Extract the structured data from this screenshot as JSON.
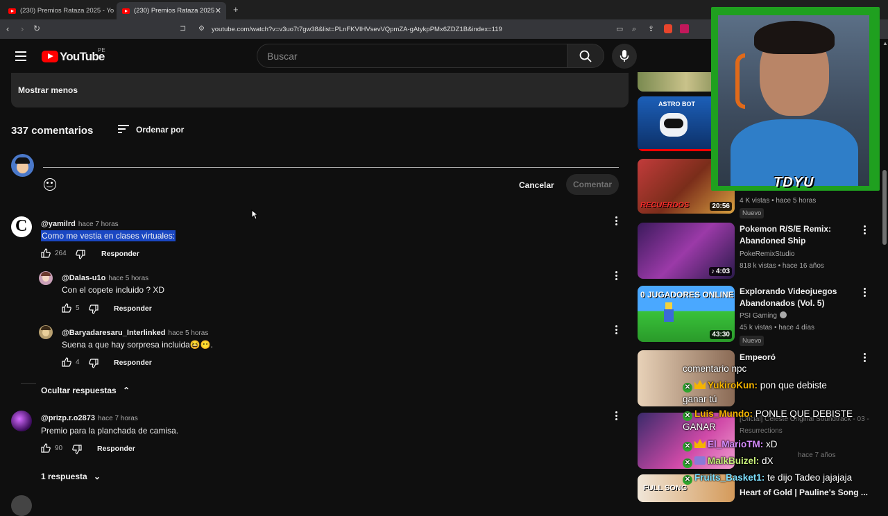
{
  "browser": {
    "tabs": [
      {
        "title": "(230) Premios Rataza 2025 - YouTube"
      },
      {
        "title": "(230) Premios Rataza 2025 - YouTube"
      }
    ],
    "new_tab_icon": "plus-icon",
    "url": "youtube.com/watch?v=v3uo7t7gw38&list=PLnFKVIHVsevVQpmZA-gAtykpPMx6ZDZ1B&index=119"
  },
  "header": {
    "logo_text": "YouTube",
    "country_code": "PE",
    "search_placeholder": "Buscar"
  },
  "description": {
    "show_less_label": "Mostrar menos"
  },
  "comments": {
    "count_label": "337 comentarios",
    "sort_label": "Ordenar por",
    "cancel_label": "Cancelar",
    "submit_label": "Comentar",
    "threads": [
      {
        "author": "@yamilrd",
        "time": "hace 7 horas",
        "text": "Como me vestia en clases virtuales:",
        "likes": "264",
        "reply_label": "Responder",
        "replies": [
          {
            "author": "@Dalas-u1o",
            "time": "hace 5 horas",
            "text": "Con el copete incluido ? XD",
            "likes": "5",
            "reply_label": "Responder"
          },
          {
            "author": "@Baryadaresaru_Interlinked",
            "time": "hace 5 horas",
            "text": "Suena a que hay sorpresa incluida",
            "emoji_suffix": "😆😶.",
            "likes": "4",
            "reply_label": "Responder"
          }
        ],
        "toggle_label": "Ocultar respuestas"
      },
      {
        "author": "@prizp.r.o2873",
        "time": "hace 7 horas",
        "text": "Premio para la planchada de camisa.",
        "likes": "90",
        "reply_label": "Responder",
        "toggle_label": "1 respuesta"
      }
    ]
  },
  "sidebar": {
    "videos": [
      {
        "duration": "",
        "title": "",
        "channel": "",
        "meta": ""
      },
      {
        "duration": "20:56",
        "thumb_text": "RECUERDOS",
        "meta": "4 K vistas • hace 5 horas",
        "badge": "Nuevo"
      },
      {
        "duration": "4:03",
        "title": "Pokemon R/S/E Remix: Abandoned Ship",
        "channel": "PokeRemixStudio",
        "meta": "818 k vistas • hace 16 años"
      },
      {
        "duration": "43:30",
        "thumb_text": "0 JUGADORES ONLINE",
        "title": "Explorando Videojuegos Abandonados (Vol. 5)",
        "channel": "PSI Gaming",
        "meta": "45 k vistas • hace 4 días",
        "badge": "Nuevo"
      },
      {
        "title": "Empeoró"
      },
      {
        "title": "[Oficial] Celeste Original Soundtrack - 03 - Resurrections",
        "meta": "hace 7 años"
      },
      {
        "thumb_text": "FULL SONG",
        "title": "Heart of Gold | Pauline's Song ..."
      }
    ],
    "astro_thumb_text": "ASTRO BOT"
  },
  "stream": {
    "cam_name": "TDYU",
    "chat": [
      {
        "user": "",
        "text": "comentario npc"
      },
      {
        "user": "YukiroKun:",
        "text": " pon que debiste",
        "cont": "ganar tú",
        "color": "#f4b400"
      },
      {
        "user": "Luis_Mundo:",
        "text": " PONLE QUE DEBISTE",
        "cont": "GANAR",
        "color": "#f4b400"
      },
      {
        "user": "El_MarioTM:",
        "text": " xD",
        "color": "#d78cff"
      },
      {
        "user": "MalkBuizel:",
        "text": " dX",
        "color": "#c8f07a"
      },
      {
        "user": "Fruits_Basket1:",
        "text": " te dijo Tadeo jajajaja",
        "color": "#7ee0ff"
      }
    ]
  },
  "colors": {
    "yt_red": "#ff0000",
    "highlight": "#1a47c2",
    "cam_border": "#1fa01f"
  }
}
